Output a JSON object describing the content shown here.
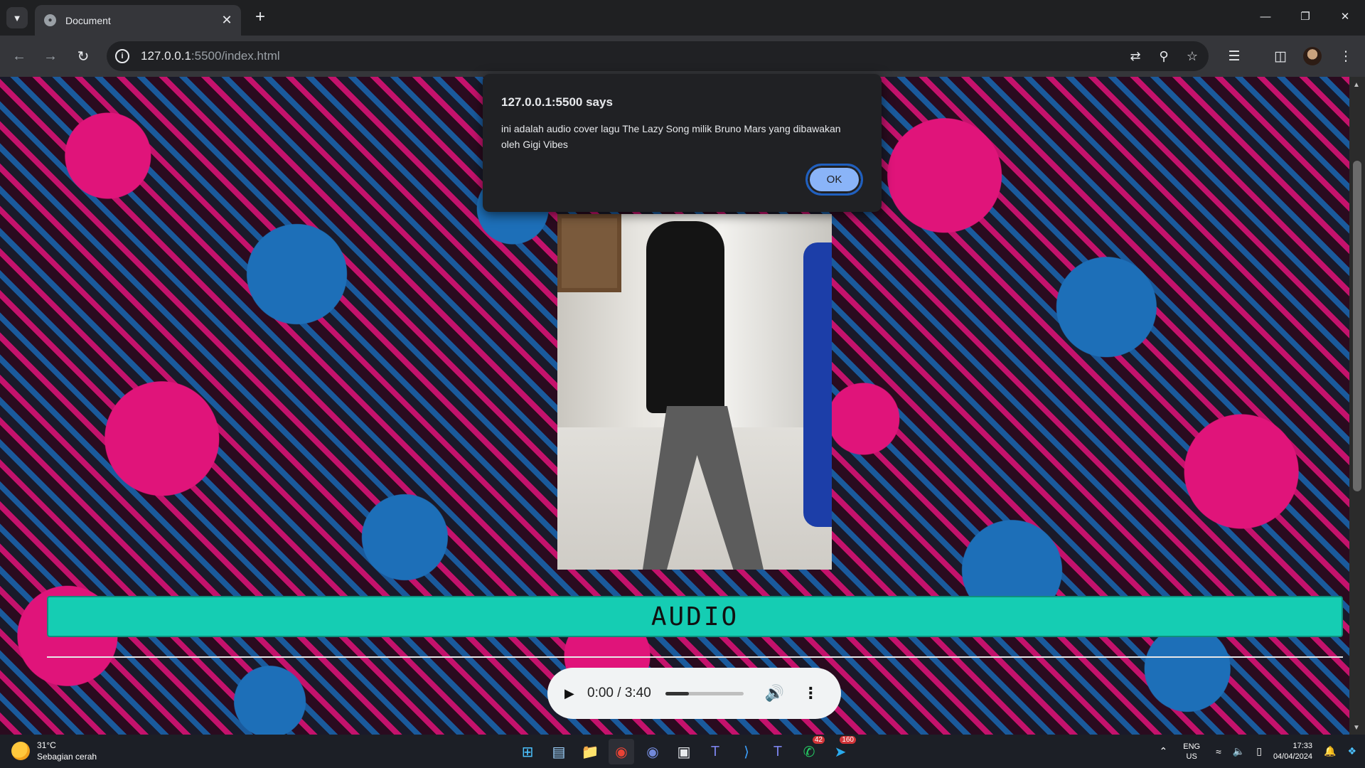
{
  "browser": {
    "tab_title": "Document",
    "url_host": "127.0.0.1",
    "url_rest": ":5500/index.html",
    "window_controls": [
      "minimize",
      "restore",
      "close"
    ]
  },
  "dialog": {
    "title": "127.0.0.1:5500 says",
    "message": "ini adalah audio  cover lagu The Lazy Song milik Bruno Mars yang dibawakan oleh Gigi Vibes",
    "ok_label": "OK"
  },
  "page": {
    "audio_heading": "AUDIO"
  },
  "audio_player": {
    "time": "0:00 / 3:40",
    "volume_level": 0.3
  },
  "taskbar": {
    "weather_temp": "31°C",
    "weather_desc": "Sebagian cerah",
    "whatsapp_badge": "42",
    "telegram_badge": "160",
    "lang_line1": "ENG",
    "lang_line2": "US",
    "time": "17:33",
    "date": "04/04/2024"
  },
  "colors": {
    "banner": "#15cdb3",
    "dialog_bg": "#202124",
    "ok_button": "#8ab4f8"
  }
}
